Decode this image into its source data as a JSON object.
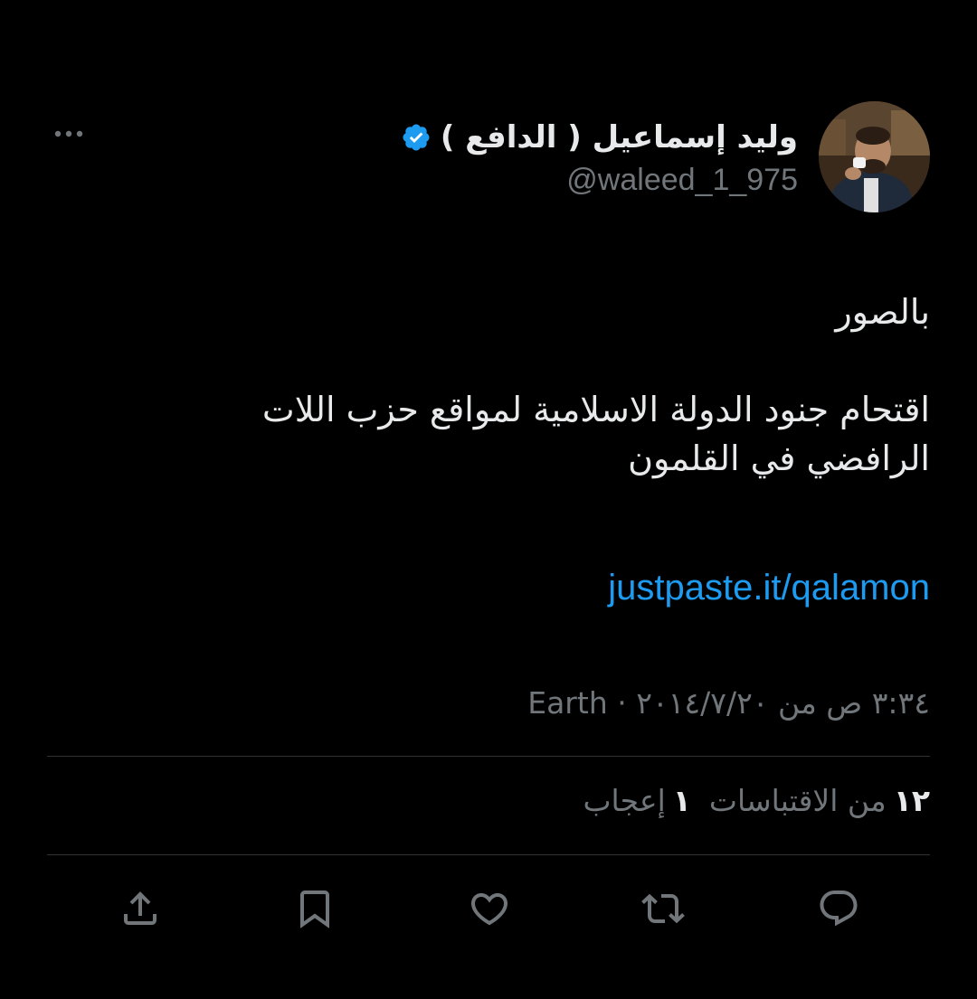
{
  "tweet": {
    "author": {
      "display_name": "وليد إسماعيل ( الدافع )",
      "handle": "@waleed_1_975",
      "verified": true,
      "avatar_icon": "profile-photo"
    },
    "text": {
      "line1": "بالصور",
      "line2": "اقتحام جنود الدولة الاسلامية لمواقع حزب اللات",
      "line3": "الرافضي في القلمون"
    },
    "link": "justpaste.it/qalamon",
    "timestamp": "٣:٣٤ ص من ٢٠١٤/٧/٢٠ · Earth",
    "stats": {
      "quotes_count": "١٢",
      "quotes_label": "من الاقتباسات",
      "likes_count": "١",
      "likes_label": "إعجاب"
    }
  },
  "icons": {
    "more": "more-icon",
    "verified": "verified-badge-icon",
    "reply": "reply-icon",
    "retweet": "retweet-icon",
    "like": "heart-icon",
    "bookmark": "bookmark-icon",
    "share": "share-icon"
  },
  "colors": {
    "background": "#000000",
    "text_primary": "#e7e9ea",
    "text_secondary": "#71767b",
    "link": "#1d9bf0",
    "verified": "#1d9bf0",
    "divider": "#2f3336"
  }
}
